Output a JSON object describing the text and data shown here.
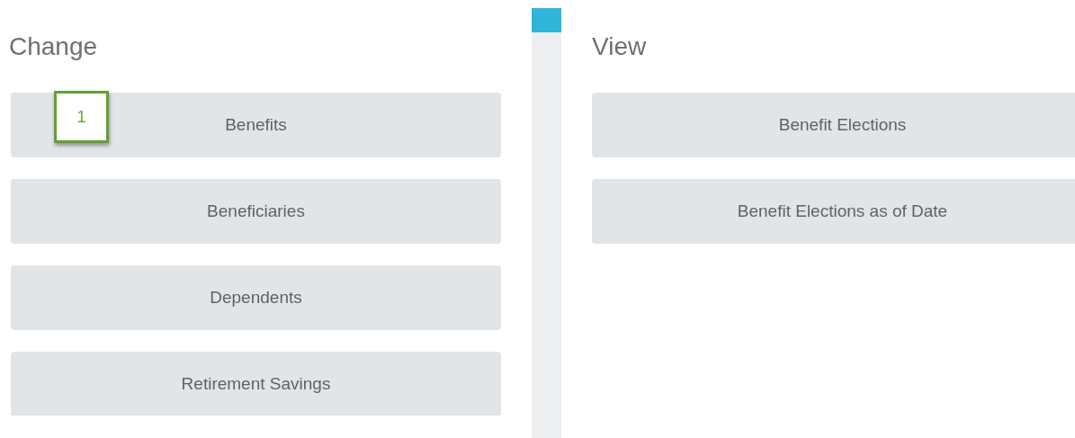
{
  "change": {
    "title": "Change",
    "buttons": [
      {
        "label": "Benefits",
        "badge": "1"
      },
      {
        "label": "Beneficiaries"
      },
      {
        "label": "Dependents"
      },
      {
        "label": "Retirement Savings"
      }
    ]
  },
  "view": {
    "title": "View",
    "buttons": [
      {
        "label": "Benefit Elections"
      },
      {
        "label": "Benefit Elections as of Date"
      }
    ]
  }
}
